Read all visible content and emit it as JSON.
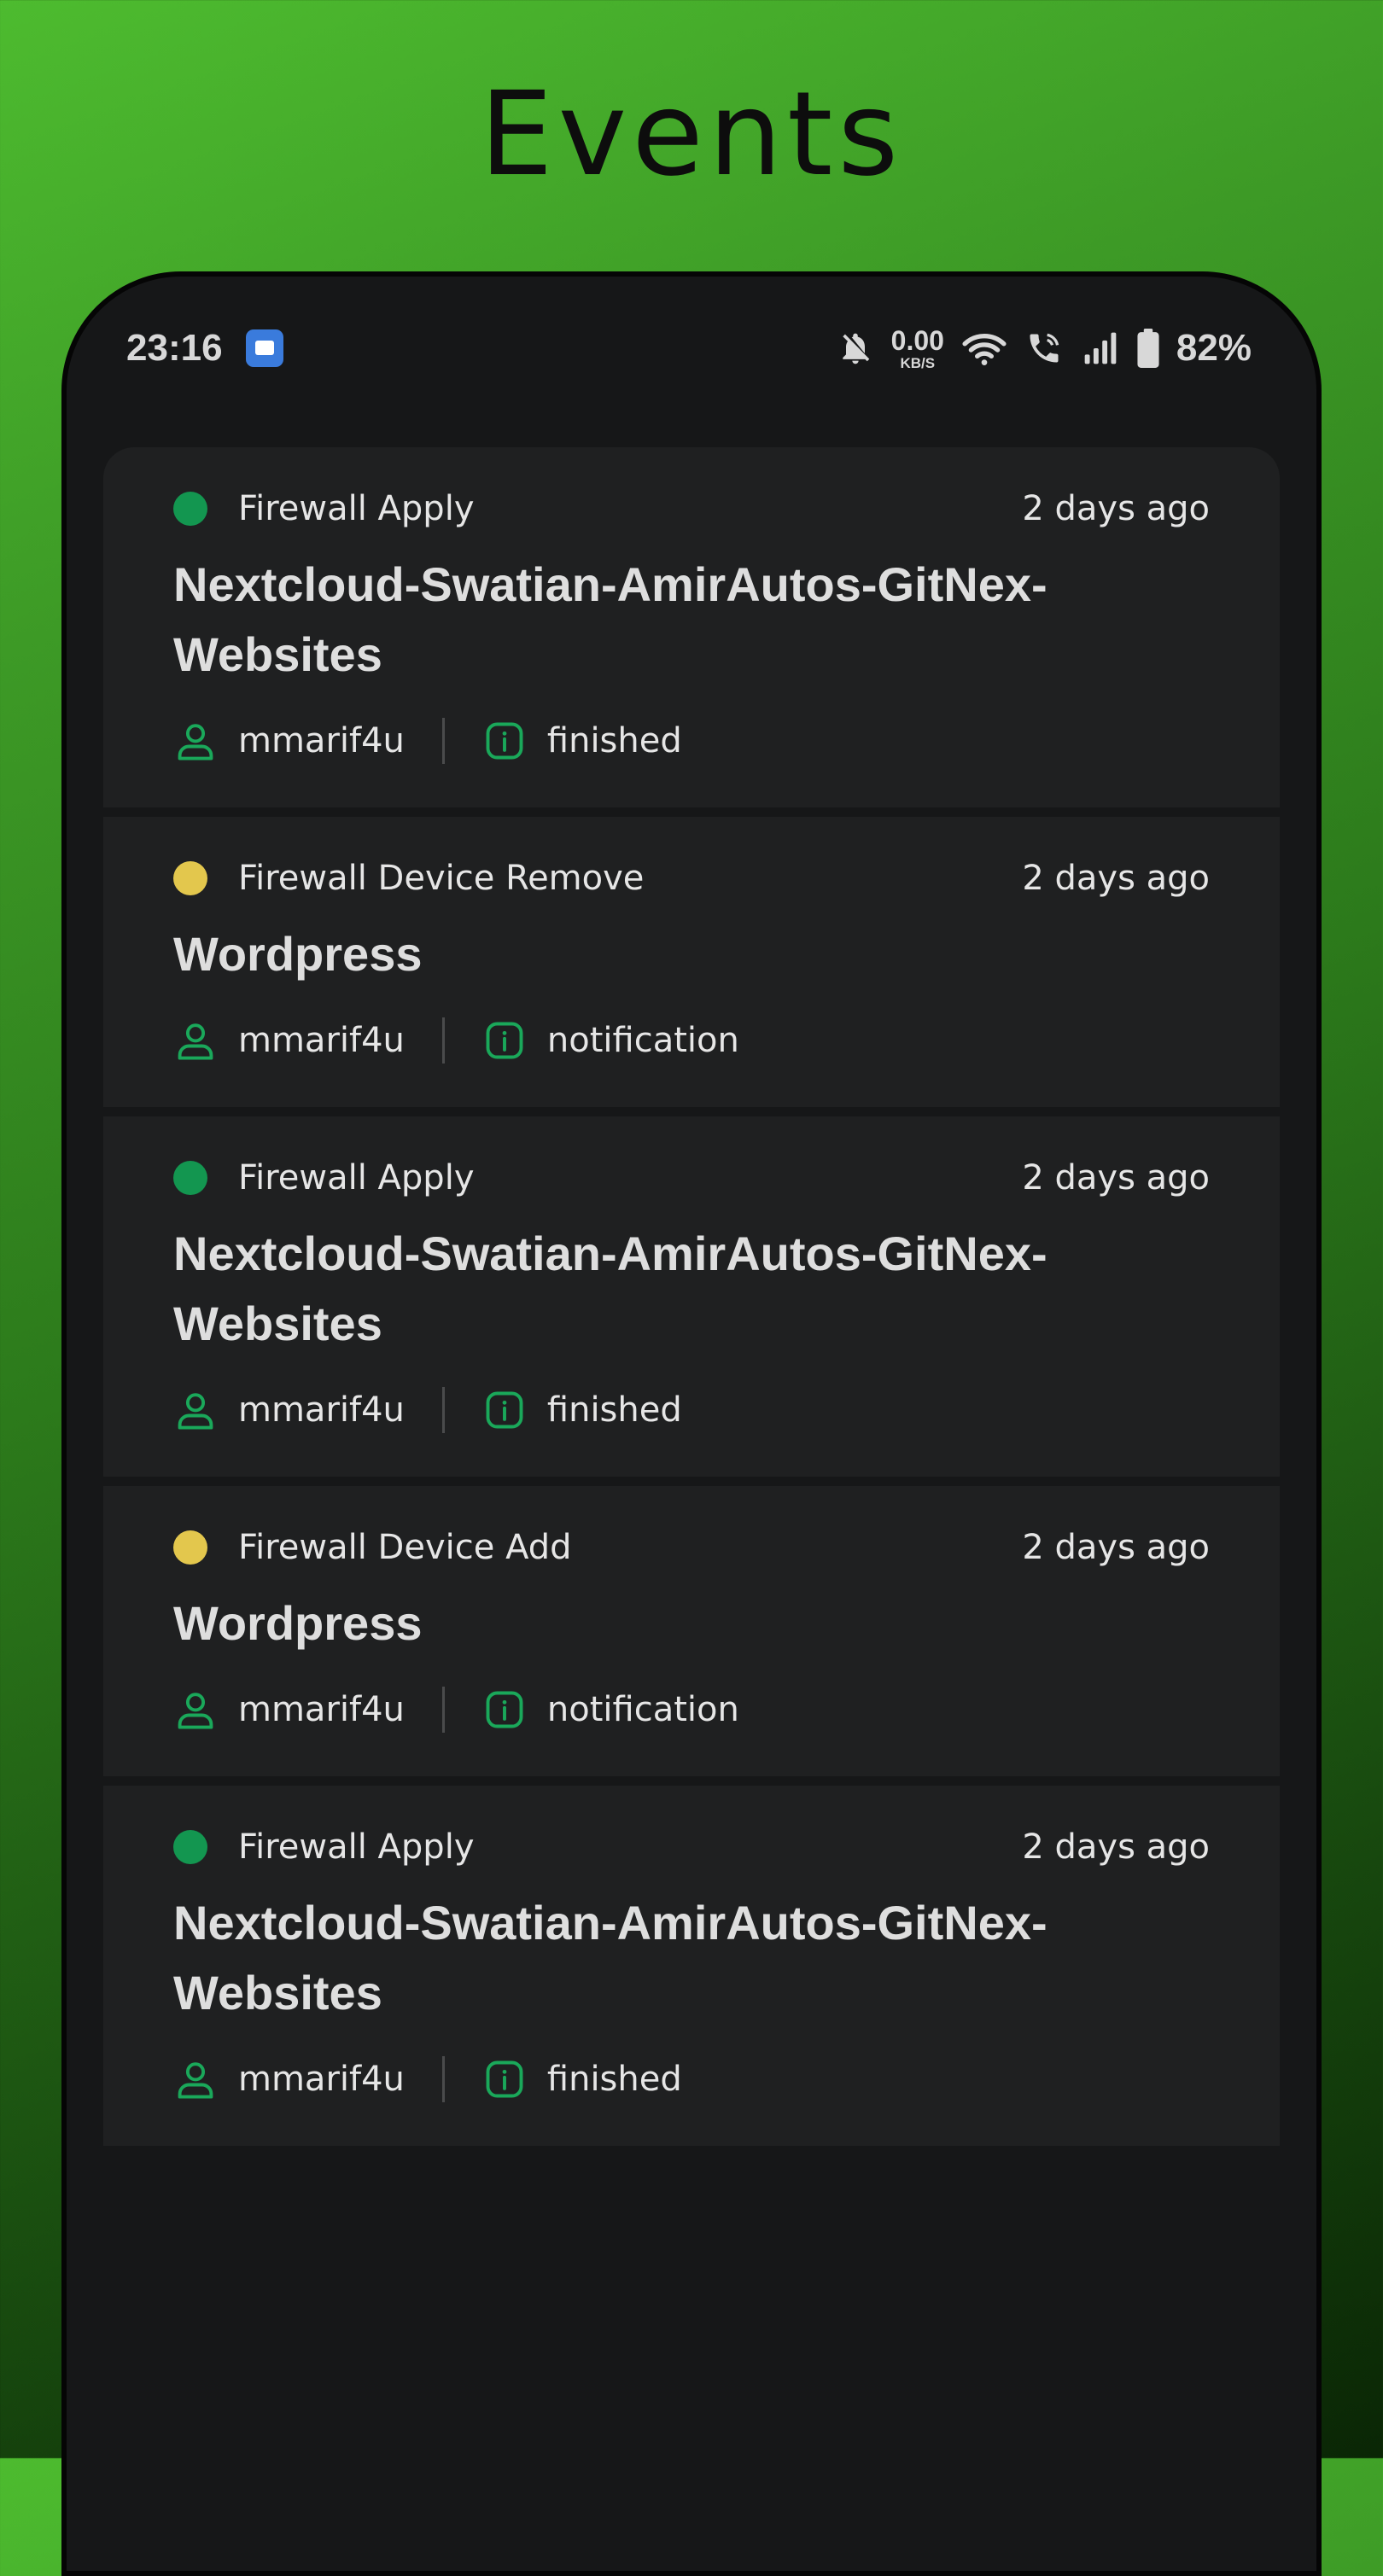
{
  "promo": {
    "title": "Events"
  },
  "status_bar": {
    "time": "23:16",
    "net_speed_value": "0.00",
    "net_speed_unit": "KB/S",
    "battery": "82%"
  },
  "colors": {
    "status_success": "#139650",
    "status_notice": "#e3c74d",
    "icon_accent": "#1aa85a"
  },
  "events": [
    {
      "type": "Firewall Apply",
      "time": "2 days ago",
      "title": "Nextcloud-Swatian-AmirAutos-GitNex-Websites",
      "user": "mmarif4u",
      "status": "finished",
      "indicator": "green"
    },
    {
      "type": "Firewall Device Remove",
      "time": "2 days ago",
      "title": "Wordpress",
      "user": "mmarif4u",
      "status": "notification",
      "indicator": "yellow"
    },
    {
      "type": "Firewall Apply",
      "time": "2 days ago",
      "title": "Nextcloud-Swatian-AmirAutos-GitNex-Websites",
      "user": "mmarif4u",
      "status": "finished",
      "indicator": "green"
    },
    {
      "type": "Firewall Device Add",
      "time": "2 days ago",
      "title": "Wordpress",
      "user": "mmarif4u",
      "status": "notification",
      "indicator": "yellow"
    },
    {
      "type": "Firewall Apply",
      "time": "2 days ago",
      "title": "Nextcloud-Swatian-AmirAutos-GitNex-Websites",
      "user": "mmarif4u",
      "status": "finished",
      "indicator": "green"
    }
  ]
}
